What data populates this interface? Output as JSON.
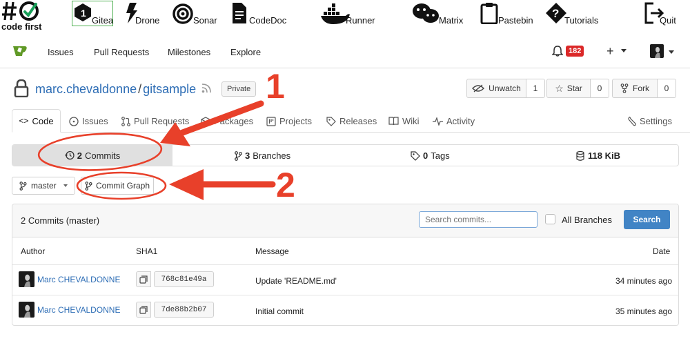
{
  "topbar": {
    "logo_line1": "#",
    "logo_line2": "code first",
    "apps": [
      {
        "label": "Gitea",
        "icon": "gitea-icon"
      },
      {
        "label": "Drone",
        "icon": "drone-icon"
      },
      {
        "label": "Sonar",
        "icon": "sonar-icon"
      },
      {
        "label": "CodeDoc",
        "icon": "document-icon"
      },
      {
        "label": "Runner",
        "icon": "docker-whale-icon"
      },
      {
        "label": "Matrix",
        "icon": "chat-bubbles-icon"
      },
      {
        "label": "Pastebin",
        "icon": "clipboard-icon"
      },
      {
        "label": "Tutorials",
        "icon": "question-icon"
      },
      {
        "label": "Quit",
        "icon": "exit-icon"
      }
    ]
  },
  "nav": {
    "items": [
      "Issues",
      "Pull Requests",
      "Milestones",
      "Explore"
    ],
    "notifications_count": "182",
    "plus_label": "+"
  },
  "repo": {
    "owner": "marc.chevaldonne",
    "separator": "/",
    "name": "gitsample",
    "visibility": "Private",
    "unwatch_label": "Unwatch",
    "unwatch_count": "1",
    "star_label": "Star",
    "star_count": "0",
    "fork_label": "Fork",
    "fork_count": "0"
  },
  "tabs": [
    "Code",
    "Issues",
    "Pull Requests",
    "Packages",
    "Projects",
    "Releases",
    "Wiki",
    "Activity",
    "Settings"
  ],
  "stats": {
    "commits_num": "2",
    "commits_label": "Commits",
    "branches_num": "3",
    "branches_label": "Branches",
    "tags_num": "0",
    "tags_label": "Tags",
    "size": "118 KiB"
  },
  "branch_select": "master",
  "commit_graph_label": "Commit Graph",
  "annotations": {
    "one": "1",
    "two": "2"
  },
  "commits_panel": {
    "title": "2 Commits (master)",
    "search_placeholder": "Search commits...",
    "all_branches_label": "All Branches",
    "search_button": "Search"
  },
  "commits_table": {
    "headers": [
      "Author",
      "SHA1",
      "Message",
      "Date"
    ],
    "rows": [
      {
        "author": "Marc CHEVALDONNE",
        "sha": "768c81e49a",
        "message": "Update 'README.md'",
        "date": "34 minutes ago"
      },
      {
        "author": "Marc CHEVALDONNE",
        "sha": "7de88b2b07",
        "message": "Initial commit",
        "date": "35 minutes ago"
      }
    ]
  },
  "colors": {
    "link": "#2d6db5",
    "accent": "#4184c5",
    "annotation": "#e8402a",
    "badge": "#db2828",
    "gitea_green": "#609926"
  }
}
